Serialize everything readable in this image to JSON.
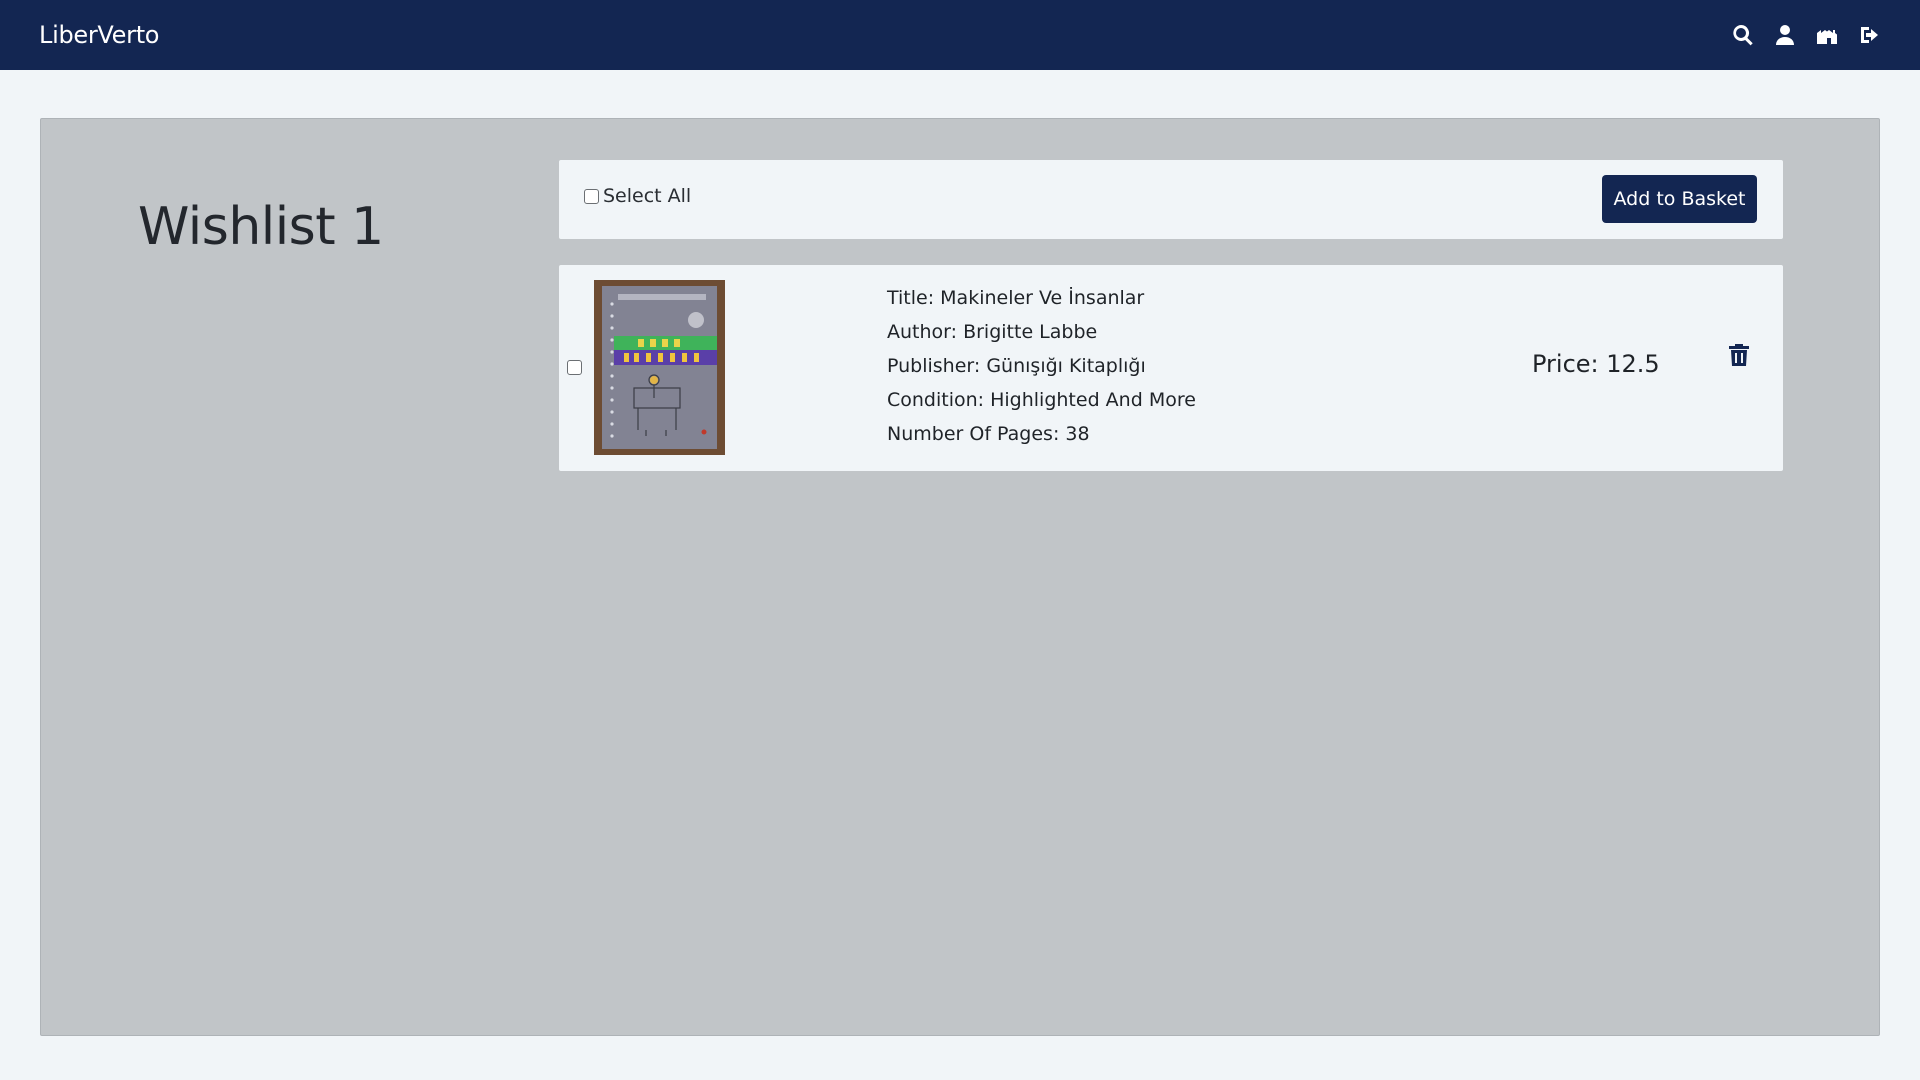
{
  "app": {
    "brand": "LiberVerto",
    "accent_color": "#132652"
  },
  "nav": {
    "icons": [
      "search-icon",
      "user-icon",
      "store-icon",
      "logout-icon"
    ]
  },
  "wishlist": {
    "title": "Wishlist 1",
    "select_all_label": "Select All",
    "add_to_basket_label": "Add to Basket",
    "items": [
      {
        "title": "Title: Makineler Ve İnsanlar",
        "author": "Author: Brigitte Labbe",
        "publisher": "Publisher: Günışığı Kitaplığı",
        "condition": "Condition: Highlighted And More",
        "pages": "Number Of Pages: 38",
        "price": "Price: 12.5",
        "checked": false
      }
    ]
  }
}
